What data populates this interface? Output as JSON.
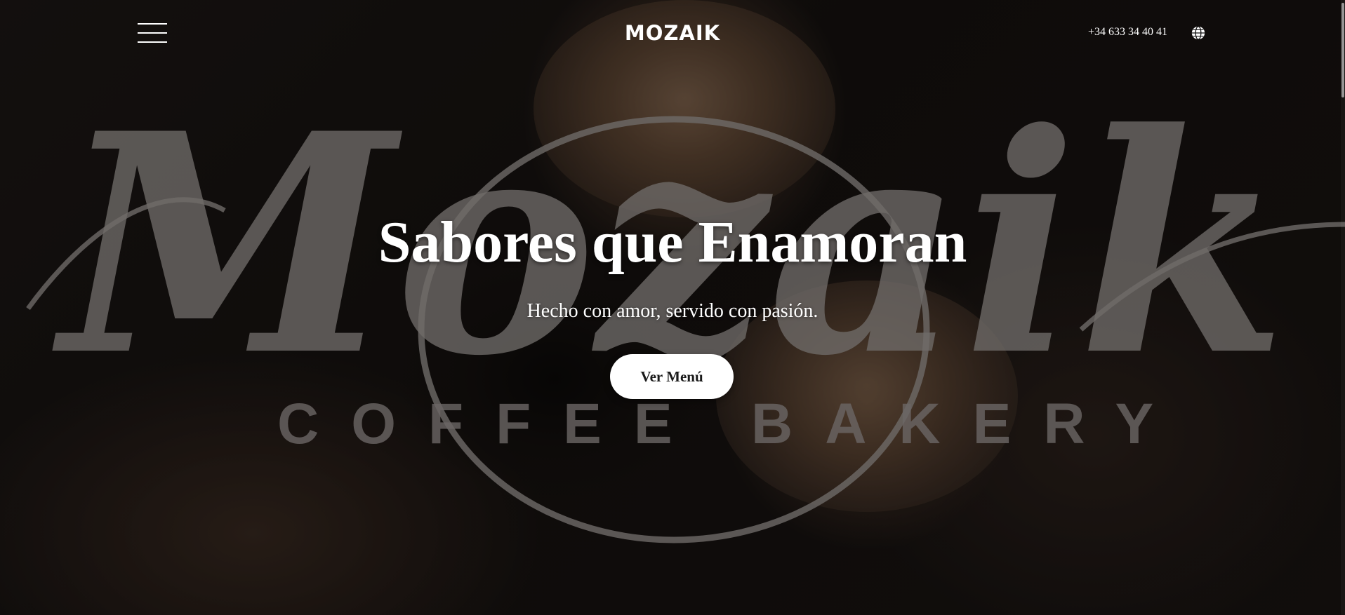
{
  "header": {
    "logo": "MOZAIK",
    "phone": "+34 633 34 40 41",
    "menu_icon": "hamburger-menu-icon",
    "language_icon": "globe-icon"
  },
  "hero": {
    "title": "Sabores que Enamoran",
    "subtitle": "Hecho con amor, servido con pasión.",
    "cta_label": "Ver Menú"
  },
  "watermark": {
    "script_text": "Mozaik",
    "left_text": "COFFEE",
    "right_text": "BAKERY"
  },
  "colors": {
    "text": "#ffffff",
    "button_bg": "#ffffff",
    "button_text": "#1a1a1a",
    "watermark": "#6f6b69",
    "overlay": "#000000"
  }
}
